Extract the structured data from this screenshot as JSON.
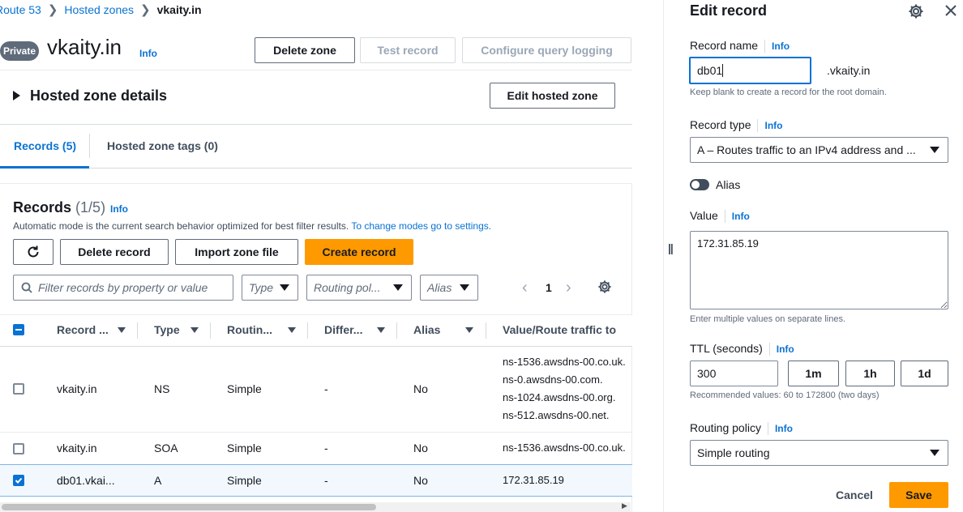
{
  "breadcrumb": {
    "items": [
      "Route 53",
      "Hosted zones",
      "vkaity.in"
    ]
  },
  "zone": {
    "badge": "Private",
    "name": "vkaity.in",
    "info": "Info",
    "buttons": {
      "delete": "Delete zone",
      "test": "Test record",
      "logging": "Configure query logging"
    }
  },
  "details": {
    "title": "Hosted zone details",
    "edit_button": "Edit hosted zone"
  },
  "tabs": [
    {
      "label": "Records (5)",
      "active": true
    },
    {
      "label": "Hosted zone tags (0)",
      "active": false
    }
  ],
  "records": {
    "title": "Records",
    "count": "(1/5)",
    "info": "Info",
    "description": "Automatic mode is the current search behavior optimized for best filter results.",
    "description_link": "To change modes go to settings.",
    "buttons": {
      "delete": "Delete record",
      "import": "Import zone file",
      "create": "Create record"
    },
    "filter_placeholder": "Filter records by property or value",
    "filters": {
      "type": "Type",
      "routing": "Routing pol...",
      "alias": "Alias"
    },
    "page": "1",
    "columns": [
      "Record ...",
      "Type",
      "Routin...",
      "Differ...",
      "Alias",
      "Value/Route traffic to"
    ],
    "rows": [
      {
        "name": "vkaity.in",
        "type": "NS",
        "routing": "Simple",
        "differ": "-",
        "alias": "No",
        "values": [
          "ns-1536.awsdns-00.co.uk.",
          "ns-0.awsdns-00.com.",
          "ns-1024.awsdns-00.org.",
          "ns-512.awsdns-00.net."
        ],
        "checked": false
      },
      {
        "name": "vkaity.in",
        "type": "SOA",
        "routing": "Simple",
        "differ": "-",
        "alias": "No",
        "values": [
          "ns-1536.awsdns-00.co.uk."
        ],
        "checked": false
      },
      {
        "name": "db01.vkai...",
        "type": "A",
        "routing": "Simple",
        "differ": "-",
        "alias": "No",
        "values": [
          "172.31.85.19"
        ],
        "checked": true
      }
    ]
  },
  "edit": {
    "title": "Edit record",
    "record_name_label": "Record name",
    "record_name_info": "Info",
    "record_name_value": "db01",
    "domain_suffix": ".vkaity.in",
    "record_name_hint": "Keep blank to create a record for the root domain.",
    "record_type_label": "Record type",
    "record_type_info": "Info",
    "record_type_value": "A – Routes traffic to an IPv4 address and ...",
    "alias_label": "Alias",
    "value_label": "Value",
    "value_info": "Info",
    "value_text": "172.31.85.19",
    "value_hint": "Enter multiple values on separate lines.",
    "ttl_label": "TTL (seconds)",
    "ttl_info": "Info",
    "ttl_value": "300",
    "ttl_buttons": [
      "1m",
      "1h",
      "1d"
    ],
    "ttl_hint": "Recommended values: 60 to 172800 (two days)",
    "routing_label": "Routing policy",
    "routing_info": "Info",
    "routing_value": "Simple routing",
    "cancel": "Cancel",
    "save": "Save"
  },
  "colors": {
    "accent": "#0972d3",
    "primary_button": "#ff9900",
    "selected_row": "#f2f8fd"
  }
}
